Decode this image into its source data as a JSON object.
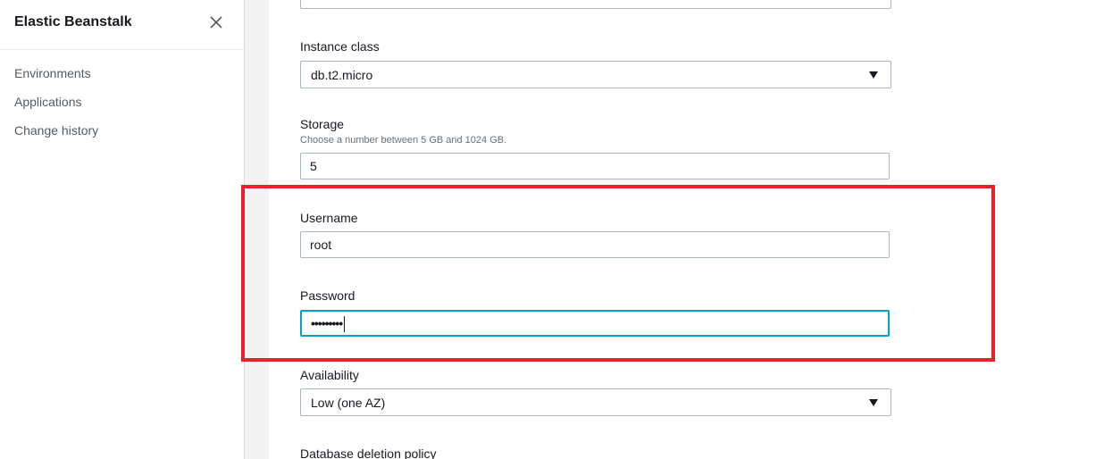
{
  "sidebar": {
    "title": "Elastic Beanstalk",
    "close_icon": "close-icon",
    "items": [
      {
        "label": "Environments"
      },
      {
        "label": "Applications"
      },
      {
        "label": "Change history"
      }
    ]
  },
  "form": {
    "instance_class": {
      "label": "Instance class",
      "value": "db.t2.micro"
    },
    "storage": {
      "label": "Storage",
      "description": "Choose a number between 5 GB and 1024 GB.",
      "value": "5"
    },
    "username": {
      "label": "Username",
      "value": "root"
    },
    "password": {
      "label": "Password",
      "masked_value": "•••••••••"
    },
    "availability": {
      "label": "Availability",
      "value": "Low (one AZ)"
    },
    "deletion_policy": {
      "label": "Database deletion policy"
    }
  },
  "colors": {
    "highlight": "#e8222d",
    "focus": "#00a1c9"
  }
}
